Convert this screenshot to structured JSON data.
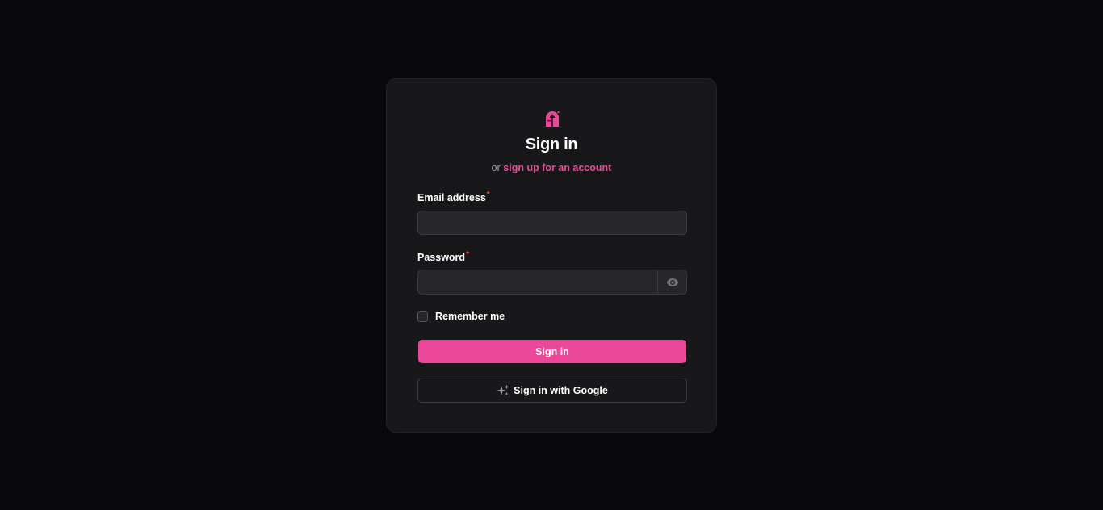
{
  "header": {
    "logo_icon": "pink-lock-icon",
    "title": "Sign in",
    "subtitle_prefix": "or",
    "signup_link": "sign up for an account"
  },
  "form": {
    "email": {
      "label": "Email address",
      "required_mark": "*",
      "value": ""
    },
    "password": {
      "label": "Password",
      "required_mark": "*",
      "value": "",
      "toggle_icon": "eye-icon"
    },
    "remember": {
      "label": "Remember me",
      "checked": false
    },
    "submit_label": "Sign in",
    "google": {
      "label": "Sign in with Google",
      "icon": "sparkles-icon"
    }
  },
  "colors": {
    "background": "#09090b",
    "card": "#18181b",
    "accent": "#ec4899",
    "required": "#ef4444"
  }
}
